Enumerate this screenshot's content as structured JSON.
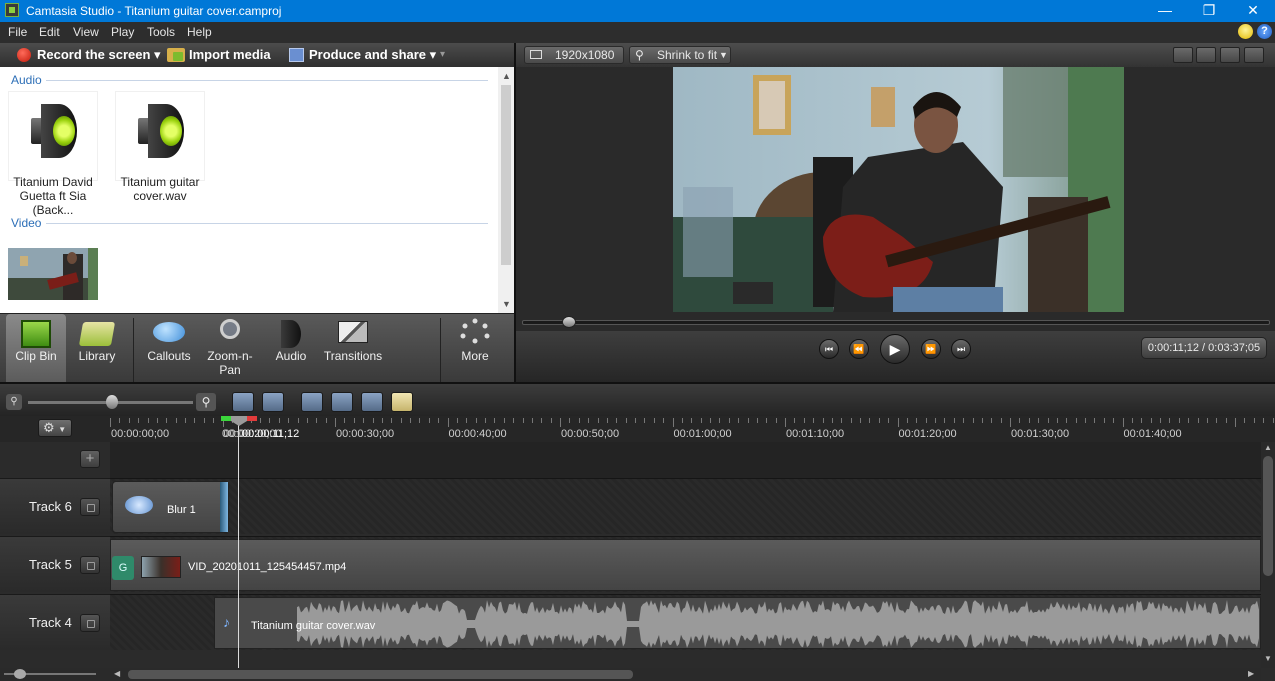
{
  "window": {
    "title": "Camtasia Studio - Titanium guitar cover.camproj"
  },
  "menu": [
    "File",
    "Edit",
    "View",
    "Play",
    "Tools",
    "Help"
  ],
  "toolbar": {
    "record": "Record the screen",
    "import": "Import media",
    "produce": "Produce and share"
  },
  "clipbin": {
    "audio_label": "Audio",
    "video_label": "Video",
    "audio_clips": [
      {
        "line1": "Titanium   David",
        "line2": "Guetta ft Sia (Back..."
      },
      {
        "line1": "Titanium guitar",
        "line2": "cover.wav"
      }
    ]
  },
  "tabs": [
    "Clip Bin",
    "Library",
    "Callouts",
    "Zoom-n-\nPan",
    "Audio",
    "Transitions",
    "More"
  ],
  "preview": {
    "resolution": "1920x1080",
    "fit": "Shrink to fit",
    "time": "0:00:11;12 / 0:03:37;05"
  },
  "timeline": {
    "ruler": [
      "00:00:00;00",
      "00:00:11;12",
      "00:00:20;00",
      "00:00:30;00",
      "00:00:40;00",
      "00:00:50;00",
      "00:01:00;00",
      "00:01:10;00",
      "00:01:20;00",
      "00:01:30;00",
      "00:01:40;00"
    ],
    "ruler_start": "00:0",
    "tracks": [
      {
        "name": "Track 6",
        "clip": "Blur 1"
      },
      {
        "name": "Track 5",
        "clip": "VID_20201011_125454457.mp4",
        "badge": "G"
      },
      {
        "name": "Track 4",
        "clip": "Titanium guitar cover.wav"
      }
    ]
  }
}
